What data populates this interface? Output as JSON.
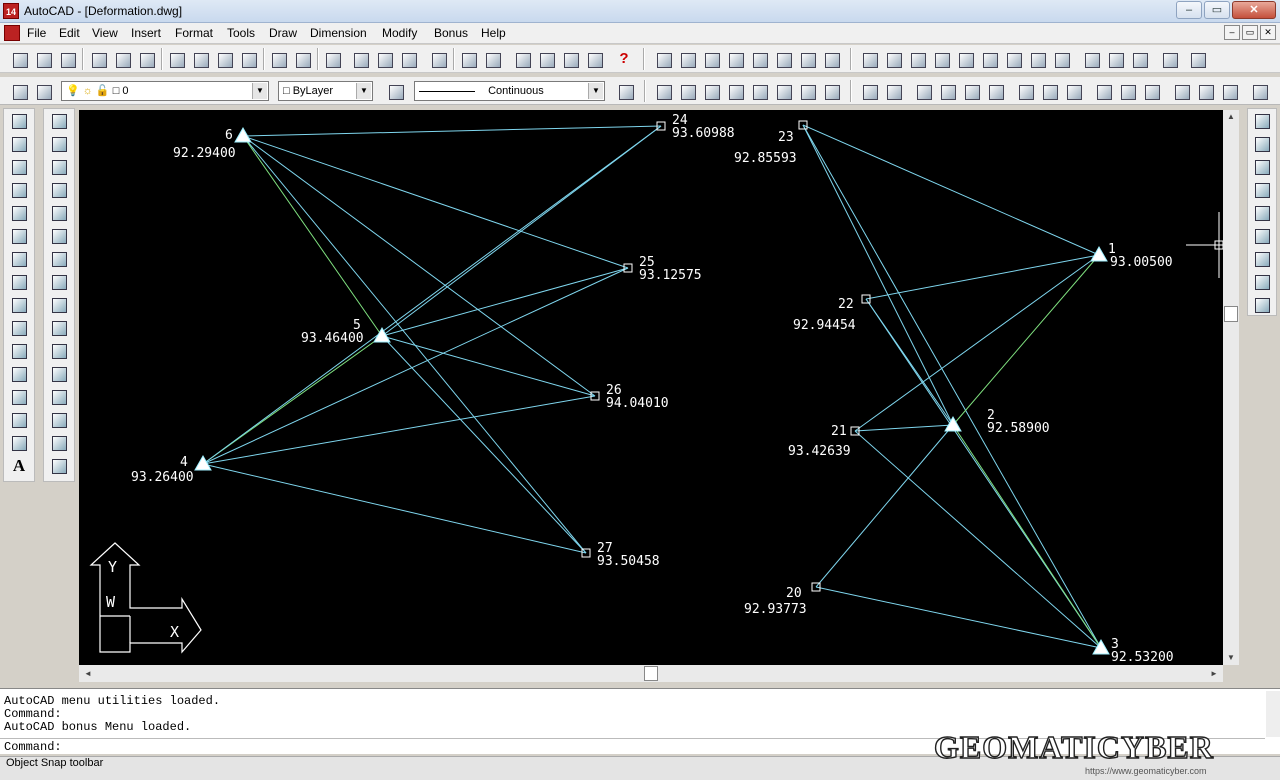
{
  "window": {
    "title": "AutoCAD - [Deformation.dwg]",
    "app_icon": "14",
    "minimize": "‒",
    "restore": "▭",
    "close": "✕"
  },
  "menu": [
    "File",
    "Edit",
    "View",
    "Insert",
    "Format",
    "Tools",
    "Draw",
    "Dimension",
    "Modify",
    "Bonus",
    "Help"
  ],
  "mdi": {
    "minimize": "‒",
    "restore": "▭",
    "close": "✕"
  },
  "layer": {
    "value": "0"
  },
  "color": {
    "value": "ByLayer"
  },
  "linetype": {
    "value": "Continuous"
  },
  "colors": {
    "background": "#000000",
    "line_cyan": "#7fd6ee",
    "line_green": "#7fe07f",
    "marker": "#ffffff",
    "text": "#ffffff"
  },
  "points": [
    {
      "id": "6",
      "elev": "92.29400",
      "kind": "triangle"
    },
    {
      "id": "24",
      "elev": "93.60988",
      "kind": "square"
    },
    {
      "id": "25",
      "elev": "93.12575",
      "kind": "square"
    },
    {
      "id": "5",
      "elev": "93.46400",
      "kind": "triangle"
    },
    {
      "id": "26",
      "elev": "94.04010",
      "kind": "square"
    },
    {
      "id": "4",
      "elev": "93.26400",
      "kind": "triangle"
    },
    {
      "id": "27",
      "elev": "93.50458",
      "kind": "square"
    },
    {
      "id": "23",
      "elev": "92.85593",
      "kind": "square"
    },
    {
      "id": "1",
      "elev": "93.00500",
      "kind": "triangle"
    },
    {
      "id": "22",
      "elev": "92.94454",
      "kind": "square"
    },
    {
      "id": "2",
      "elev": "92.58900",
      "kind": "triangle"
    },
    {
      "id": "21",
      "elev": "93.42639",
      "kind": "square"
    },
    {
      "id": "20",
      "elev": "92.93773",
      "kind": "square"
    },
    {
      "id": "3",
      "elev": "92.53200",
      "kind": "triangle"
    }
  ],
  "ucs": {
    "y": "Y",
    "w": "W",
    "x": "X"
  },
  "command_window": {
    "lines": [
      "AutoCAD menu utilities loaded.",
      "Command:",
      "AutoCAD bonus Menu loaded."
    ],
    "prompt": "Command:"
  },
  "status": {
    "text": "Object Snap toolbar"
  },
  "watermark": {
    "text": "GEOMATICYBER",
    "url": "https://www.geomaticyber.com"
  }
}
